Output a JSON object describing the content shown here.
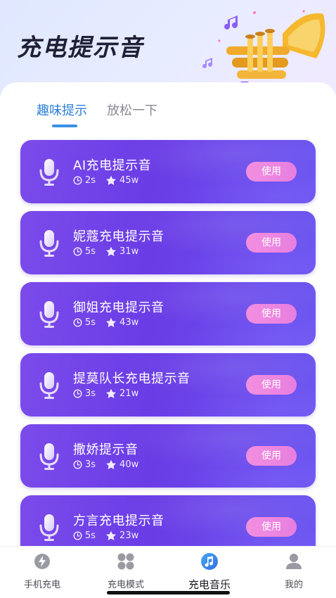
{
  "header": {
    "title": "充电提示音"
  },
  "tabs": [
    {
      "label": "趣味提示",
      "active": true
    },
    {
      "label": "放松一下",
      "active": false
    }
  ],
  "cards": [
    {
      "title": "AI充电提示音",
      "duration": "2s",
      "likes": "45w",
      "button": "使用"
    },
    {
      "title": "妮蔻充电提示音",
      "duration": "5s",
      "likes": "31w",
      "button": "使用"
    },
    {
      "title": "御姐充电提示音",
      "duration": "5s",
      "likes": "43w",
      "button": "使用"
    },
    {
      "title": "提莫队长充电提示音",
      "duration": "3s",
      "likes": "21w",
      "button": "使用"
    },
    {
      "title": "撒娇提示音",
      "duration": "3s",
      "likes": "40w",
      "button": "使用"
    },
    {
      "title": "方言充电提示音",
      "duration": "5s",
      "likes": "23w",
      "button": "使用"
    }
  ],
  "tabbar": [
    {
      "label": "手机充电",
      "icon": "lightning-icon",
      "active": false
    },
    {
      "label": "充电模式",
      "icon": "grid-icon",
      "active": false
    },
    {
      "label": "充电音乐",
      "icon": "music-note-icon",
      "active": true
    },
    {
      "label": "我的",
      "icon": "user-icon",
      "active": false
    }
  ],
  "colors": {
    "card_gradient_start": "#7b4bea",
    "card_gradient_end": "#6a55f0",
    "use_button": "#ef89e0",
    "tab_active": "#2c7fd8",
    "tabbar_active": "#3a8fe8"
  }
}
